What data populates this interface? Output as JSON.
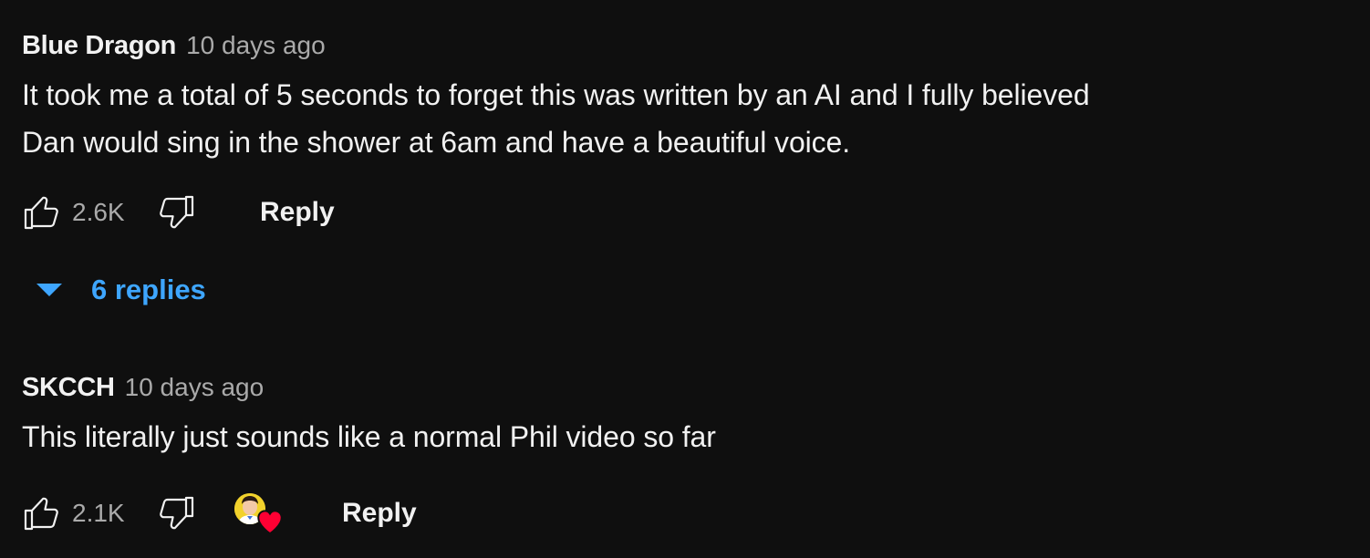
{
  "comments": [
    {
      "author": "Blue Dragon",
      "timestamp": "10 days ago",
      "text": "It took me a total of 5 seconds to forget this was written by an AI and I fully believed\nDan would sing in the shower at 6am and have a beautiful voice.",
      "likes": "2.6K",
      "reply_label": "Reply",
      "replies_label": "6 replies",
      "creator_hearted": false
    },
    {
      "author": "SKCCH",
      "timestamp": "10 days ago",
      "text": "This literally just sounds like a normal Phil video so far",
      "likes": "2.1K",
      "reply_label": "Reply",
      "creator_hearted": true
    }
  ],
  "icons": {
    "like": "thumbs-up-icon",
    "dislike": "thumbs-down-icon",
    "expand": "caret-down-icon",
    "creator_heart": "heart-icon"
  },
  "colors": {
    "background": "#0f0f0f",
    "primary_text": "#f1f1f1",
    "secondary_text": "#aaaaaa",
    "link": "#3ea6ff",
    "heart": "#ff0033",
    "avatar_bg": "#f2d22c"
  }
}
